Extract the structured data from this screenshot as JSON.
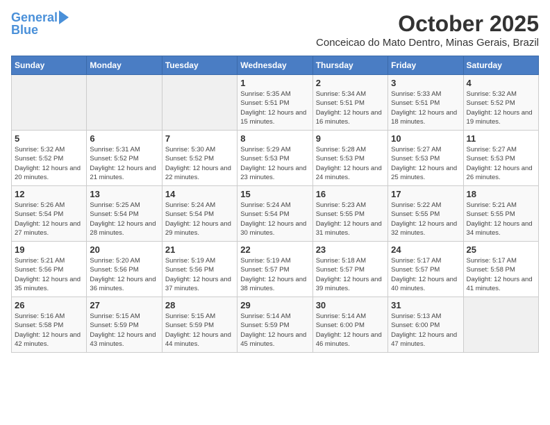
{
  "header": {
    "logo_line1": "General",
    "logo_line2": "Blue",
    "month_title": "October 2025",
    "subtitle": "Conceicao do Mato Dentro, Minas Gerais, Brazil"
  },
  "columns": [
    "Sunday",
    "Monday",
    "Tuesday",
    "Wednesday",
    "Thursday",
    "Friday",
    "Saturday"
  ],
  "weeks": [
    [
      {
        "day": "",
        "sunrise": "",
        "sunset": "",
        "daylight": ""
      },
      {
        "day": "",
        "sunrise": "",
        "sunset": "",
        "daylight": ""
      },
      {
        "day": "",
        "sunrise": "",
        "sunset": "",
        "daylight": ""
      },
      {
        "day": "1",
        "sunrise": "Sunrise: 5:35 AM",
        "sunset": "Sunset: 5:51 PM",
        "daylight": "Daylight: 12 hours and 15 minutes."
      },
      {
        "day": "2",
        "sunrise": "Sunrise: 5:34 AM",
        "sunset": "Sunset: 5:51 PM",
        "daylight": "Daylight: 12 hours and 16 minutes."
      },
      {
        "day": "3",
        "sunrise": "Sunrise: 5:33 AM",
        "sunset": "Sunset: 5:51 PM",
        "daylight": "Daylight: 12 hours and 18 minutes."
      },
      {
        "day": "4",
        "sunrise": "Sunrise: 5:32 AM",
        "sunset": "Sunset: 5:52 PM",
        "daylight": "Daylight: 12 hours and 19 minutes."
      }
    ],
    [
      {
        "day": "5",
        "sunrise": "Sunrise: 5:32 AM",
        "sunset": "Sunset: 5:52 PM",
        "daylight": "Daylight: 12 hours and 20 minutes."
      },
      {
        "day": "6",
        "sunrise": "Sunrise: 5:31 AM",
        "sunset": "Sunset: 5:52 PM",
        "daylight": "Daylight: 12 hours and 21 minutes."
      },
      {
        "day": "7",
        "sunrise": "Sunrise: 5:30 AM",
        "sunset": "Sunset: 5:52 PM",
        "daylight": "Daylight: 12 hours and 22 minutes."
      },
      {
        "day": "8",
        "sunrise": "Sunrise: 5:29 AM",
        "sunset": "Sunset: 5:53 PM",
        "daylight": "Daylight: 12 hours and 23 minutes."
      },
      {
        "day": "9",
        "sunrise": "Sunrise: 5:28 AM",
        "sunset": "Sunset: 5:53 PM",
        "daylight": "Daylight: 12 hours and 24 minutes."
      },
      {
        "day": "10",
        "sunrise": "Sunrise: 5:27 AM",
        "sunset": "Sunset: 5:53 PM",
        "daylight": "Daylight: 12 hours and 25 minutes."
      },
      {
        "day": "11",
        "sunrise": "Sunrise: 5:27 AM",
        "sunset": "Sunset: 5:53 PM",
        "daylight": "Daylight: 12 hours and 26 minutes."
      }
    ],
    [
      {
        "day": "12",
        "sunrise": "Sunrise: 5:26 AM",
        "sunset": "Sunset: 5:54 PM",
        "daylight": "Daylight: 12 hours and 27 minutes."
      },
      {
        "day": "13",
        "sunrise": "Sunrise: 5:25 AM",
        "sunset": "Sunset: 5:54 PM",
        "daylight": "Daylight: 12 hours and 28 minutes."
      },
      {
        "day": "14",
        "sunrise": "Sunrise: 5:24 AM",
        "sunset": "Sunset: 5:54 PM",
        "daylight": "Daylight: 12 hours and 29 minutes."
      },
      {
        "day": "15",
        "sunrise": "Sunrise: 5:24 AM",
        "sunset": "Sunset: 5:54 PM",
        "daylight": "Daylight: 12 hours and 30 minutes."
      },
      {
        "day": "16",
        "sunrise": "Sunrise: 5:23 AM",
        "sunset": "Sunset: 5:55 PM",
        "daylight": "Daylight: 12 hours and 31 minutes."
      },
      {
        "day": "17",
        "sunrise": "Sunrise: 5:22 AM",
        "sunset": "Sunset: 5:55 PM",
        "daylight": "Daylight: 12 hours and 32 minutes."
      },
      {
        "day": "18",
        "sunrise": "Sunrise: 5:21 AM",
        "sunset": "Sunset: 5:55 PM",
        "daylight": "Daylight: 12 hours and 34 minutes."
      }
    ],
    [
      {
        "day": "19",
        "sunrise": "Sunrise: 5:21 AM",
        "sunset": "Sunset: 5:56 PM",
        "daylight": "Daylight: 12 hours and 35 minutes."
      },
      {
        "day": "20",
        "sunrise": "Sunrise: 5:20 AM",
        "sunset": "Sunset: 5:56 PM",
        "daylight": "Daylight: 12 hours and 36 minutes."
      },
      {
        "day": "21",
        "sunrise": "Sunrise: 5:19 AM",
        "sunset": "Sunset: 5:56 PM",
        "daylight": "Daylight: 12 hours and 37 minutes."
      },
      {
        "day": "22",
        "sunrise": "Sunrise: 5:19 AM",
        "sunset": "Sunset: 5:57 PM",
        "daylight": "Daylight: 12 hours and 38 minutes."
      },
      {
        "day": "23",
        "sunrise": "Sunrise: 5:18 AM",
        "sunset": "Sunset: 5:57 PM",
        "daylight": "Daylight: 12 hours and 39 minutes."
      },
      {
        "day": "24",
        "sunrise": "Sunrise: 5:17 AM",
        "sunset": "Sunset: 5:57 PM",
        "daylight": "Daylight: 12 hours and 40 minutes."
      },
      {
        "day": "25",
        "sunrise": "Sunrise: 5:17 AM",
        "sunset": "Sunset: 5:58 PM",
        "daylight": "Daylight: 12 hours and 41 minutes."
      }
    ],
    [
      {
        "day": "26",
        "sunrise": "Sunrise: 5:16 AM",
        "sunset": "Sunset: 5:58 PM",
        "daylight": "Daylight: 12 hours and 42 minutes."
      },
      {
        "day": "27",
        "sunrise": "Sunrise: 5:15 AM",
        "sunset": "Sunset: 5:59 PM",
        "daylight": "Daylight: 12 hours and 43 minutes."
      },
      {
        "day": "28",
        "sunrise": "Sunrise: 5:15 AM",
        "sunset": "Sunset: 5:59 PM",
        "daylight": "Daylight: 12 hours and 44 minutes."
      },
      {
        "day": "29",
        "sunrise": "Sunrise: 5:14 AM",
        "sunset": "Sunset: 5:59 PM",
        "daylight": "Daylight: 12 hours and 45 minutes."
      },
      {
        "day": "30",
        "sunrise": "Sunrise: 5:14 AM",
        "sunset": "Sunset: 6:00 PM",
        "daylight": "Daylight: 12 hours and 46 minutes."
      },
      {
        "day": "31",
        "sunrise": "Sunrise: 5:13 AM",
        "sunset": "Sunset: 6:00 PM",
        "daylight": "Daylight: 12 hours and 47 minutes."
      },
      {
        "day": "",
        "sunrise": "",
        "sunset": "",
        "daylight": ""
      }
    ]
  ]
}
